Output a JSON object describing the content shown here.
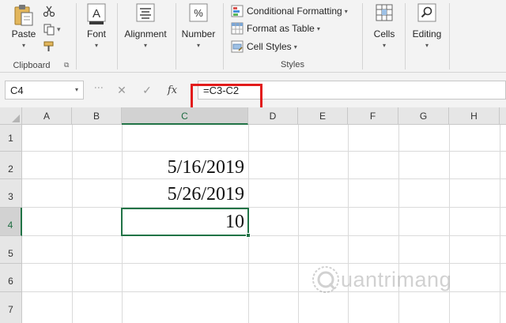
{
  "ribbon": {
    "clipboard": {
      "paste_label": "Paste",
      "group_label": "Clipboard"
    },
    "font": {
      "label": "Font",
      "icon": "font-color-icon"
    },
    "alignment": {
      "label": "Alignment",
      "icon": "align-icon"
    },
    "number": {
      "label": "Number",
      "icon": "percent-icon",
      "glyph": "%"
    },
    "styles": {
      "conditional_formatting": "Conditional Formatting",
      "format_as_table": "Format as Table",
      "cell_styles": "Cell Styles",
      "group_label": "Styles"
    },
    "cells": {
      "label": "Cells"
    },
    "editing": {
      "label": "Editing"
    }
  },
  "formula_bar": {
    "name_box": "C4",
    "formula": "=C3-C2",
    "fx_label": "fx"
  },
  "grid": {
    "columns": [
      "A",
      "B",
      "C",
      "D",
      "E",
      "F",
      "G",
      "H"
    ],
    "rows": [
      "1",
      "2",
      "3",
      "4",
      "5",
      "6",
      "7"
    ],
    "selected_column": "C",
    "selected_row": "4",
    "cells": {
      "C2": "5/16/2019",
      "C3": "5/26/2019",
      "C4": "10"
    }
  },
  "watermark": {
    "text": "uantrimang"
  },
  "colors": {
    "accent": "#217346",
    "highlight": "#e21b1b"
  }
}
